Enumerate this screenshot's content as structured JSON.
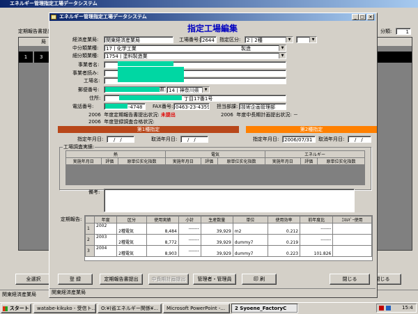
{
  "back_window": {
    "title": "エネルギー管理指定工場データシステム",
    "left_label": "定期報告書提出",
    "col_header": "局",
    "row_number": "1",
    "row_value": "3",
    "right_label": "分類:",
    "right_value": "1",
    "btn_select_all": "全選択",
    "btn_close": "閉じる",
    "status_text": "関東経済産業局"
  },
  "dialog": {
    "title": "エネルギー管理指定工場データシステム",
    "heading": "指定工場編集",
    "bureau_label": "経済産業局:",
    "bureau_value": "関東経済産業局",
    "factory_no_label": "工場番号:",
    "factory_no_value": "2644",
    "designation_label": "指定区分:",
    "designation_value": "2 | 2種",
    "mid_industry_label": "中分類業種:",
    "mid_industry_value": "17 | 化学工業",
    "mid_industry_right": "製造",
    "sub_industry_label": "細分類業種:",
    "sub_industry_value": "1754 | 塗料製造業",
    "biz_name_label": "事業者名:",
    "biz_reading_label": "事業者読み:",
    "factory_name_label": "工場名:",
    "postal_label": "郵便番号:",
    "pref_label": "県:",
    "pref_value": "14 | 神奈川県",
    "address_label": "住所:",
    "address_tail": "丁目17番1号",
    "phone_label": "電話番号:",
    "phone_tail": "-4748",
    "fax_label": "FAX番号:",
    "fax_value": "0463-23-4359",
    "dept_label": "担当部課:",
    "dept_value": "技術企画管理部",
    "report_year": "2006",
    "report_status_label": "年度定期報告書提出状況:",
    "report_status_value": "未提出",
    "plan_year": "2006",
    "plan_status_label": "年度中長期計画提出状況:",
    "plan_status_value": "－",
    "audit_year": "2006",
    "audit_status_label": "年度登録調査合格状況:",
    "audit_status_value": "",
    "first_label": "第1種指定",
    "second_label": "第2種指定",
    "first_desig_date_label": "指定年月日:",
    "first_desig_date_value": "__/__/__",
    "first_cancel_label": "取消年月日:",
    "first_cancel_value": "__/__/__",
    "second_desig_date_label": "指定年月日:",
    "second_desig_date_value": "2006/07/31",
    "second_cancel_label": "取消年月日:",
    "second_cancel_value": "__/__/__",
    "survey_group_label": "工場調査実績:",
    "survey_groups": [
      "熱",
      "電気",
      "エネルギー"
    ],
    "survey_cols": [
      "実施年月日",
      "評価",
      "原単位实化指数"
    ],
    "remarks_label": "備考:",
    "periodic_label": "定期報告:",
    "periodic_headers": [
      "年度",
      "区分",
      "使用実績",
      "小計",
      "生産数量",
      "単位",
      "使用効率",
      "前年度比",
      "ｴﾈﾙｷﾞｰ使用"
    ],
    "periodic_rows": [
      {
        "no": "1",
        "year": "2002",
        "kind": "2種電気",
        "usage": "8,484",
        "subtotal": "-------",
        "prod": "39,929",
        "unit": "m2",
        "eff": "0.212",
        "ratio": "-------"
      },
      {
        "no": "2",
        "year": "2003",
        "kind": "2種電気",
        "usage": "8,772",
        "subtotal": "-------",
        "prod": "39,929",
        "unit": "dummy7",
        "eff": "0.219",
        "ratio": "-------"
      },
      {
        "no": "3",
        "year": "2004",
        "kind": "2種電気",
        "usage": "8,903",
        "subtotal": "-------",
        "prod": "39,929",
        "unit": "dummy7",
        "eff": "0.223",
        "ratio": "101.826"
      }
    ],
    "btn_register": "登 録",
    "btn_submit_report": "定期報告書提出",
    "btn_submit_plan": "中長期計画提出",
    "btn_admin": "管理者・管理員",
    "btn_print": "印 刷",
    "btn_close": "閉じる",
    "status_left": "関東経済産業局"
  },
  "taskbar": {
    "start_label": "スタート",
    "items": [
      "watabe-kikuko - 受信ト...",
      "O:¥(省エネルギー関係¥...",
      "Microsoft PowerPoint -...",
      "2 Syoene_FactoryC"
    ],
    "clock": "15:4"
  }
}
